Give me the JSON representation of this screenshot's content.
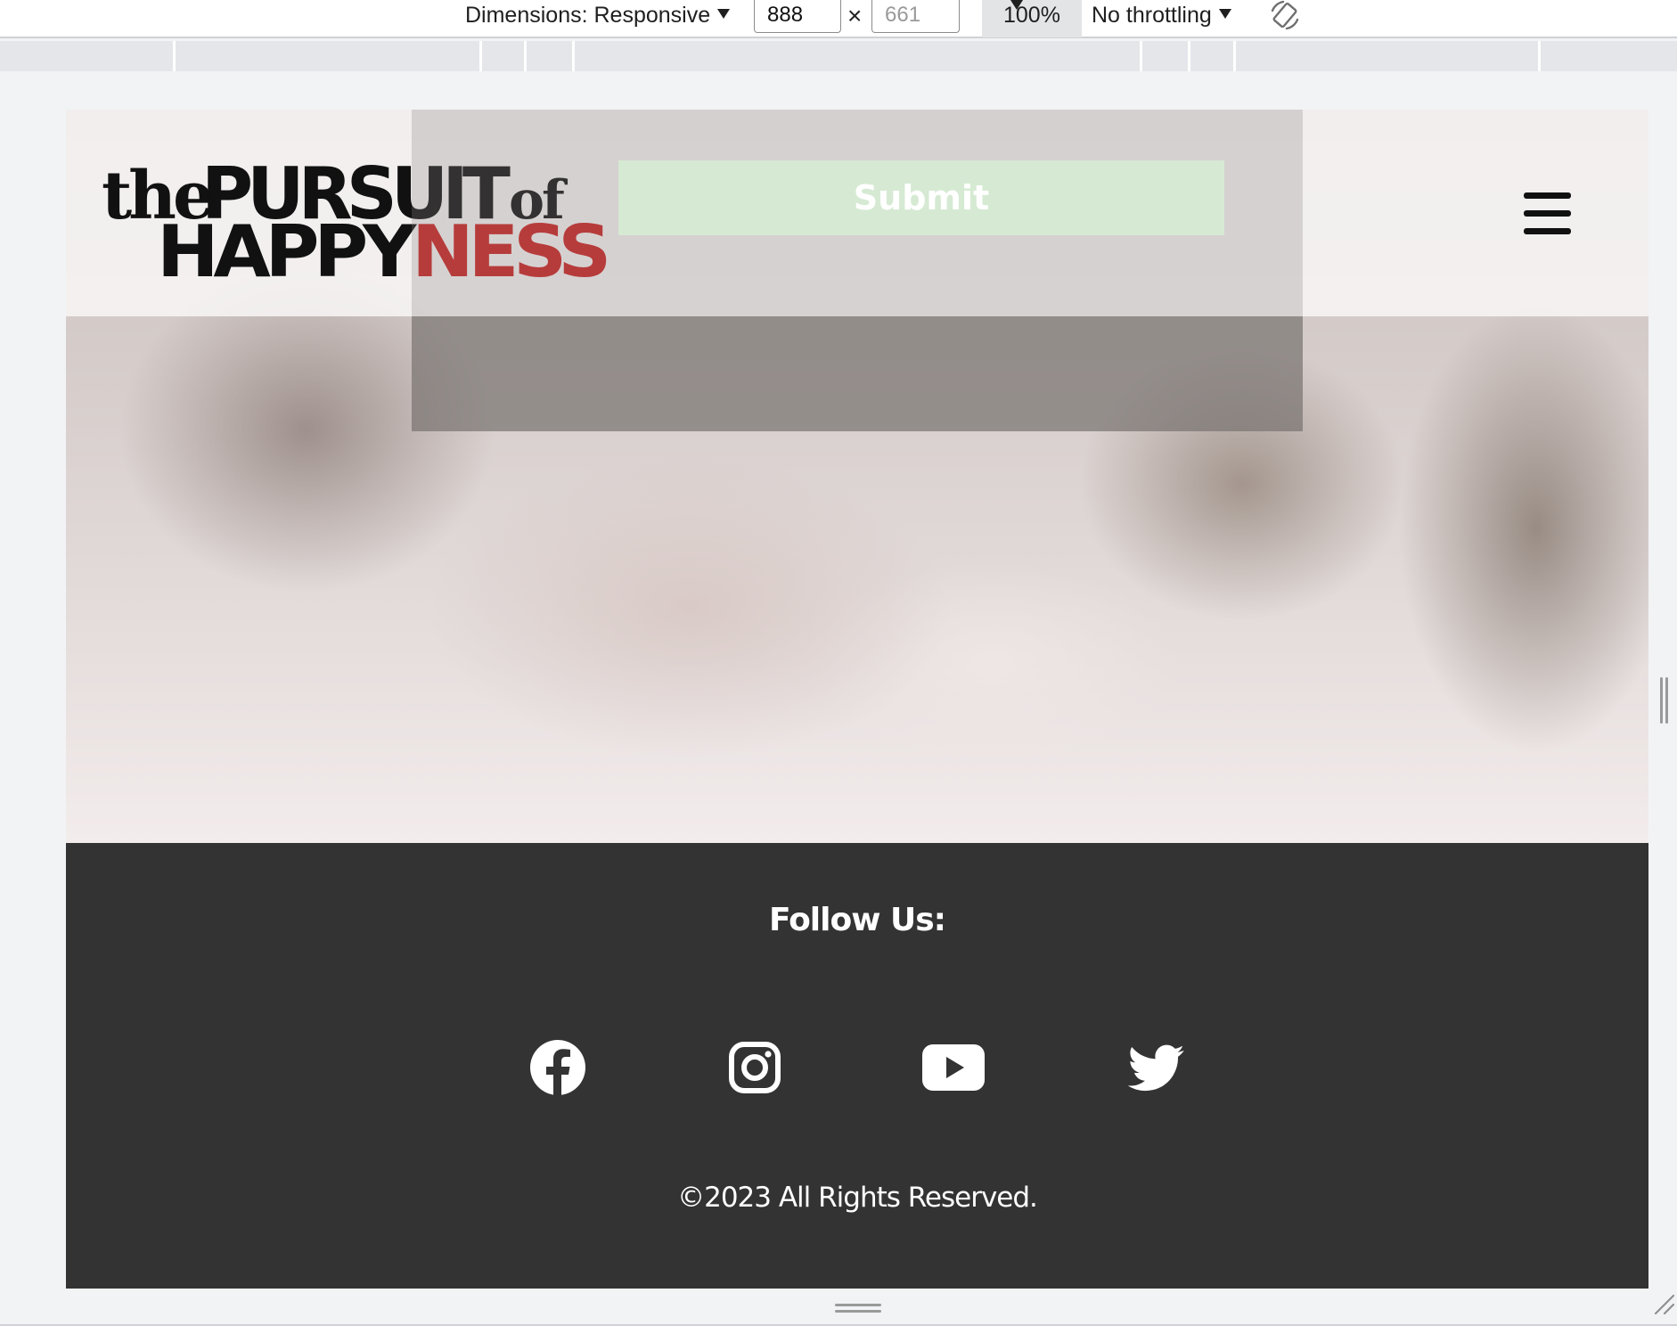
{
  "toolbar": {
    "dimensions_label": "Dimensions: Responsive",
    "width_value": "888",
    "height_value": "661",
    "times_glyph": "×",
    "zoom_label": "100%",
    "throttling_label": "No throttling"
  },
  "site": {
    "logo": {
      "word_the": "the",
      "word_pursuit": "PURSUIT",
      "word_of": "of",
      "word_happy": "HAPPY",
      "word_ness": "NESS"
    },
    "form": {
      "submit_label": "Submit"
    },
    "footer": {
      "follow_title": "Follow Us:",
      "social": [
        "facebook-icon",
        "instagram-icon",
        "youtube-icon",
        "twitter-icon"
      ],
      "copyright": "©2023 All Rights Reserved."
    }
  },
  "colors": {
    "footer_bg": "#333333",
    "submit_bg": "#d6ead3",
    "logo_black": "#111111",
    "logo_red": "#c6201f"
  }
}
